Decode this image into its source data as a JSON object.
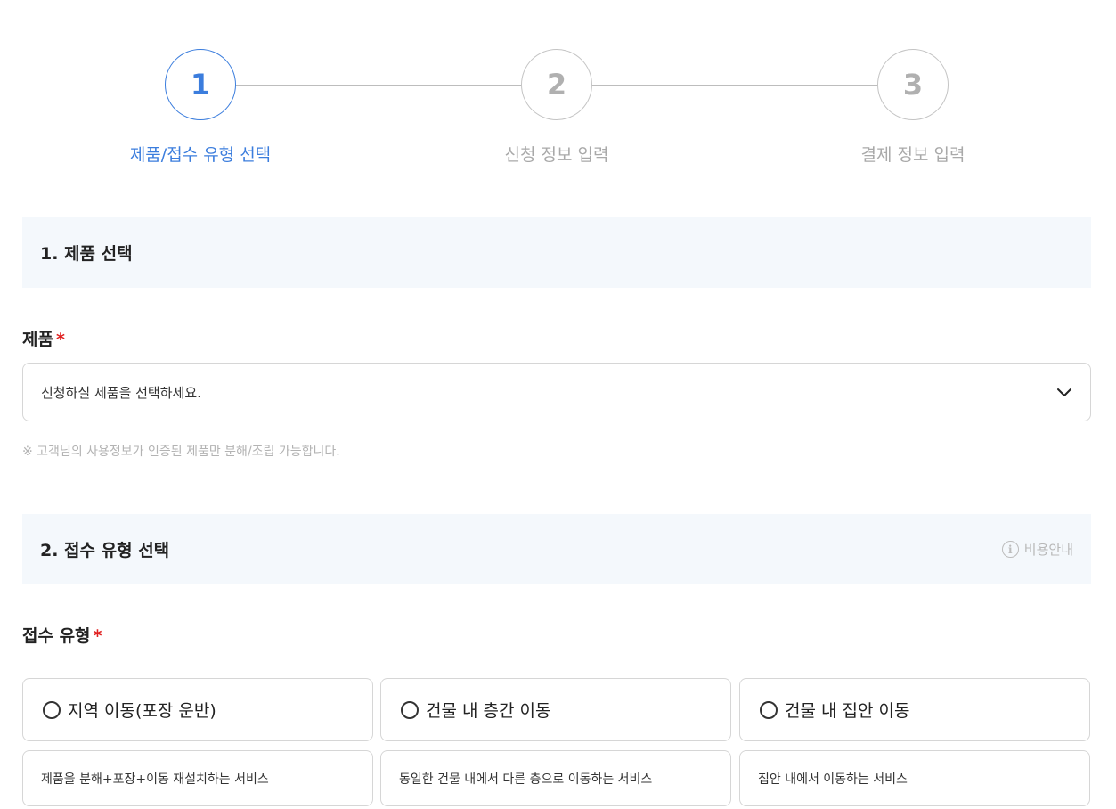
{
  "stepper": {
    "steps": [
      {
        "number": "1",
        "label": "제품/접수 유형 선택",
        "state": "active"
      },
      {
        "number": "2",
        "label": "신청 정보 입력",
        "state": "inactive"
      },
      {
        "number": "3",
        "label": "결제 정보 입력",
        "state": "inactive"
      }
    ]
  },
  "section1": {
    "title": "1. 제품 선택",
    "product_label": "제품",
    "required_mark": "*",
    "select_value": "신청하실 제품을 선택하세요.",
    "note": "※ 고객님의 사용정보가 인증된 제품만 분해/조립 가능합니다."
  },
  "section2": {
    "title": "2. 접수 유형 선택",
    "fee_link": "비용안내",
    "type_label": "접수 유형",
    "required_mark": "*",
    "options": [
      {
        "label": "지역 이동(포장 운반)",
        "description": "제품을 분해+포장+이동 재설치하는 서비스",
        "selected": false
      },
      {
        "label": "건물 내 층간 이동",
        "description": "동일한 건물 내에서 다른 층으로 이동하는 서비스",
        "selected": false
      },
      {
        "label": "건물 내 집안 이동",
        "description": "집안 내에서 이동하는 서비스",
        "selected": false
      }
    ]
  },
  "colors": {
    "accent": "#3b7ddd",
    "inactive": "#b0b0b0",
    "section_bg": "#f4f8fc",
    "required": "#e02020"
  },
  "icons": {
    "select": "chevron-down-icon",
    "fee": "info-icon",
    "option": "radio-unchecked-icon"
  }
}
